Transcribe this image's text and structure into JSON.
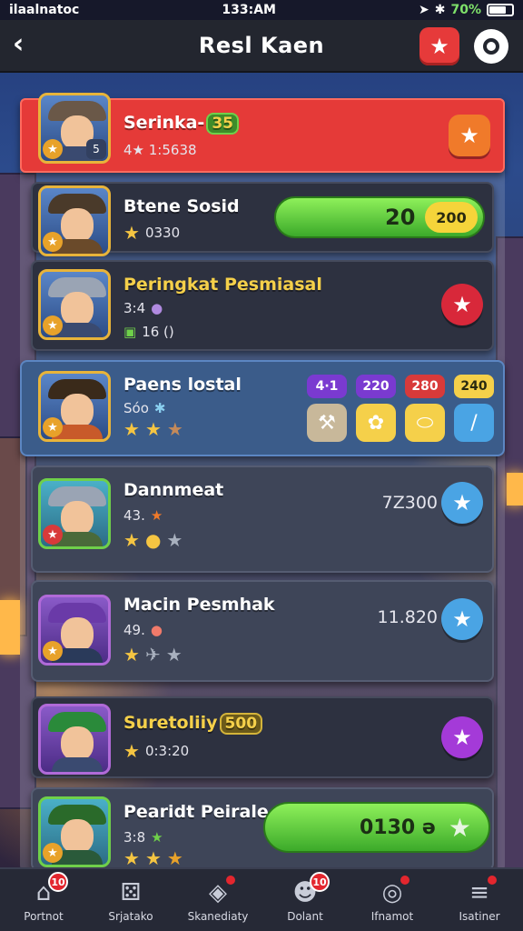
{
  "status": {
    "carrier": "ilaalnatoc",
    "time": "133:AM",
    "battery_pct": "70%",
    "battery_level": 0.7
  },
  "header": {
    "back_label": "‹",
    "title": "Resl Kaen"
  },
  "rows": [
    {
      "name": "Serinka-",
      "tag": "35",
      "sub": "4★ 1:5638"
    },
    {
      "name": "Btene Sosid",
      "sub": "0330",
      "bar_value": "20",
      "bar_badge": "200"
    },
    {
      "name": "Peringkat Pesmiasal",
      "sub1": "3:4",
      "sub2": "16 ()"
    },
    {
      "name": "Paens lostal",
      "sub": "Sóo",
      "badges": [
        "4·1",
        "220",
        "280",
        "240"
      ]
    },
    {
      "name": "Dannmeat",
      "sub": "43.",
      "score": "7Z300"
    },
    {
      "name": "Macin Pesmhak",
      "sub": "49.",
      "score": "11.820"
    },
    {
      "name": "Suretoliiy",
      "tag": "500",
      "sub": "0:3:20"
    },
    {
      "name": "Pearidt Peirale",
      "sub": "3:8",
      "bar_value": "0130 ə"
    }
  ],
  "nav": [
    {
      "label": "Portnot",
      "badge": "10",
      "icon": "home-icon"
    },
    {
      "label": "Srjatako",
      "icon": "dice-icon"
    },
    {
      "label": "Skanediaty",
      "icon": "box-icon"
    },
    {
      "label": "Dolant",
      "badge": "10",
      "icon": "group-icon"
    },
    {
      "label": "Ifnamot",
      "icon": "target-icon"
    },
    {
      "label": "Isatiner",
      "icon": "menu-icon"
    }
  ],
  "colors": {
    "accent_red": "#e53a38",
    "green": "#6fd04a",
    "gold": "#f5c542"
  }
}
